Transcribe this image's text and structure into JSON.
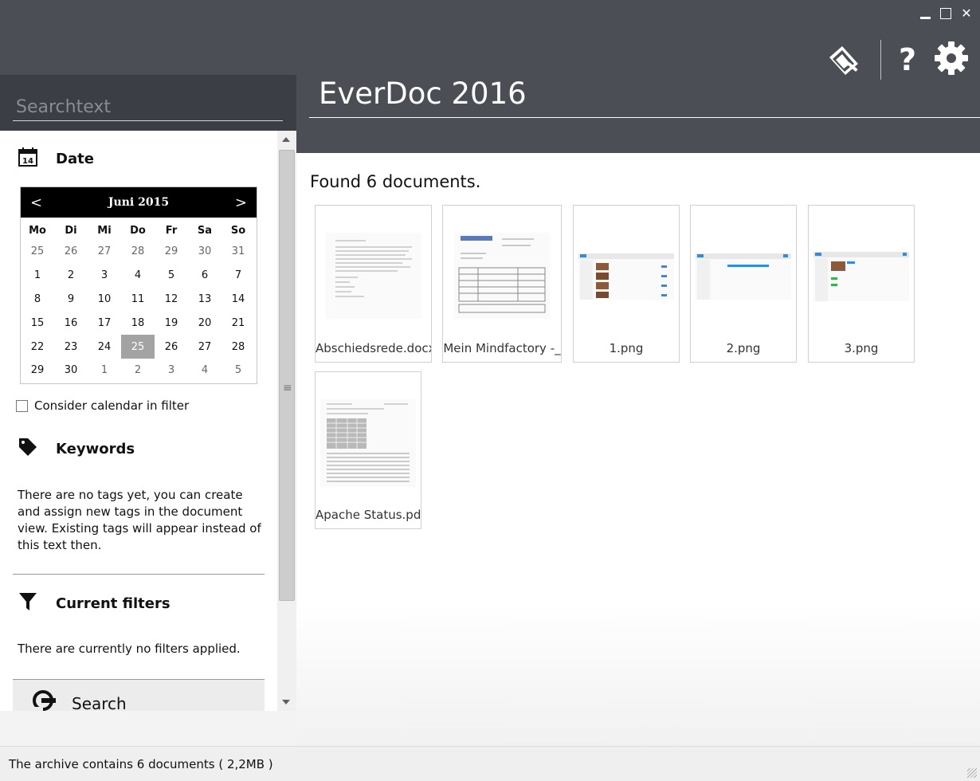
{
  "app": {
    "title": "EverDoc 2016"
  },
  "window_controls": {
    "minimize": "",
    "maximize": "",
    "close": "✕"
  },
  "toolbar": {
    "help_label": "?"
  },
  "search": {
    "placeholder": "Searchtext"
  },
  "date_section": {
    "title": "Date",
    "icon_label": "14",
    "calendar": {
      "month": "Juni 2015",
      "prev": "<",
      "next": ">",
      "weekdays": [
        "Mo",
        "Di",
        "Mi",
        "Do",
        "Fr",
        "Sa",
        "So"
      ],
      "days": [
        [
          "25",
          "26",
          "27",
          "28",
          "29",
          "30",
          "31"
        ],
        [
          "1",
          "2",
          "3",
          "4",
          "5",
          "6",
          "7"
        ],
        [
          "8",
          "9",
          "10",
          "11",
          "12",
          "13",
          "14"
        ],
        [
          "15",
          "16",
          "17",
          "18",
          "19",
          "20",
          "21"
        ],
        [
          "22",
          "23",
          "24",
          "25",
          "26",
          "27",
          "28"
        ],
        [
          "29",
          "30",
          "1",
          "2",
          "3",
          "4",
          "5"
        ]
      ],
      "selected": "25"
    },
    "consider_label": "Consider calendar in filter"
  },
  "keywords_section": {
    "title": "Keywords",
    "text": "There are no tags yet, you can create and assign new tags in the document view. Existing tags will appear instead of this text then."
  },
  "filters_section": {
    "title": "Current filters",
    "text": "There are currently no filters applied."
  },
  "search_button": {
    "label": "Search"
  },
  "results": {
    "found_text": "Found 6 documents.",
    "documents": [
      {
        "name": "Abschiedsrede.docx"
      },
      {
        "name": "Mein Mindfactory -_"
      },
      {
        "name": "1.png"
      },
      {
        "name": "2.png"
      },
      {
        "name": "3.png"
      },
      {
        "name": "Apache Status.pdf"
      }
    ]
  },
  "status": {
    "text": "The archive contains 6 documents ( 2,2MB )"
  },
  "colors": {
    "header": "#4b4e55",
    "search_bg": "#3b3e45",
    "selected_day": "#a3a3a3"
  }
}
